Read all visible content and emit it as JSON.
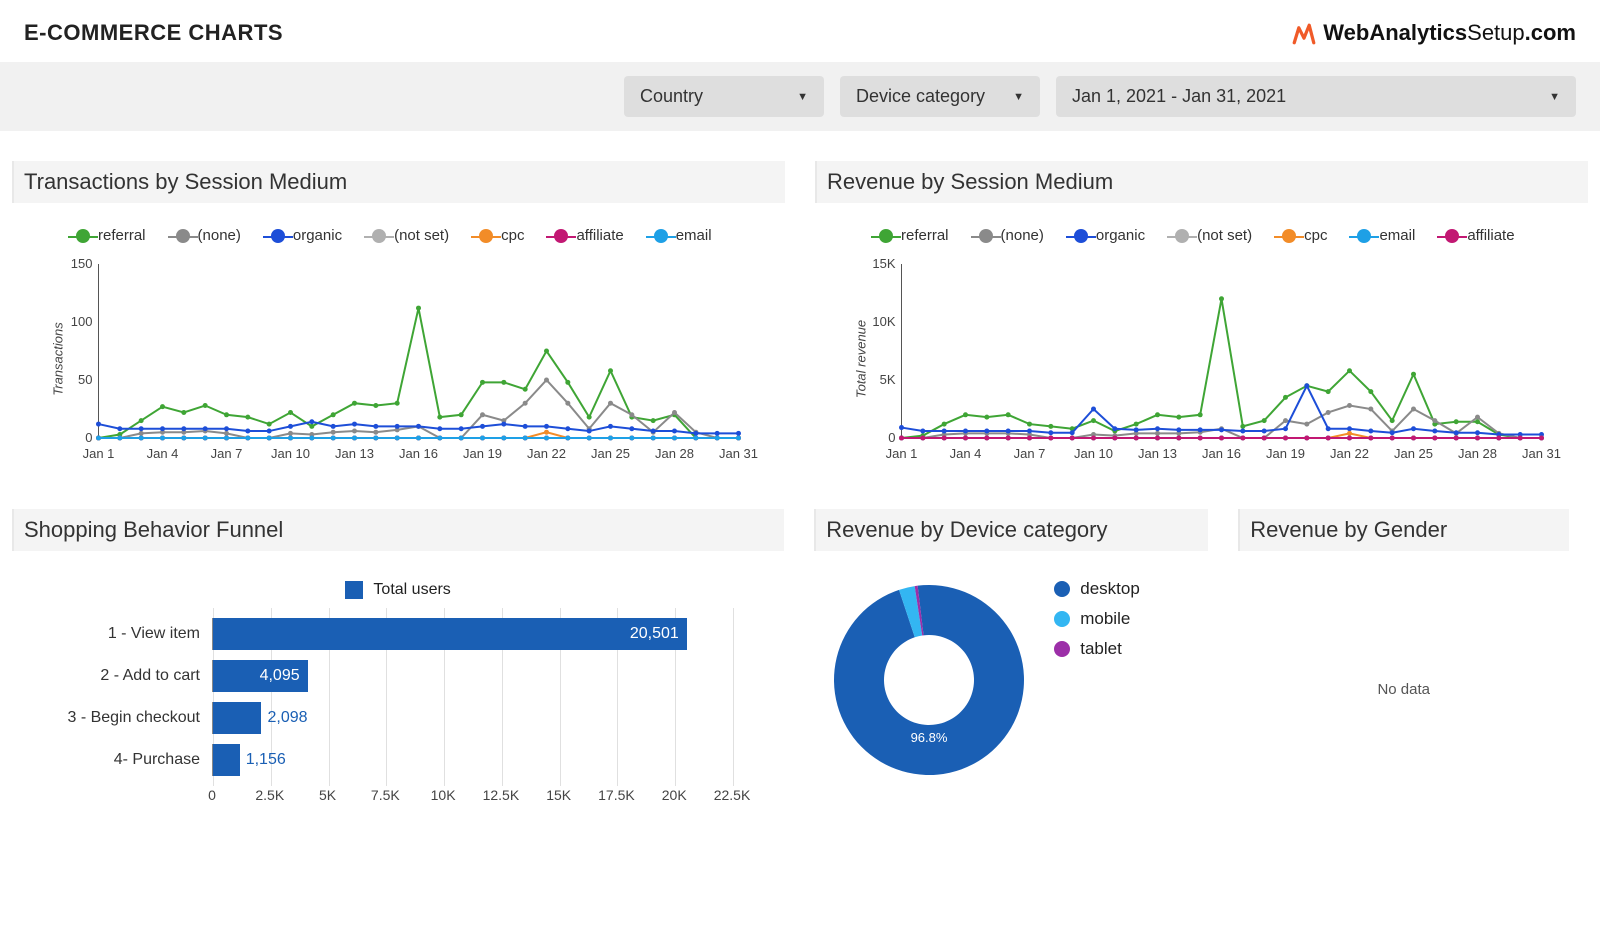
{
  "header": {
    "title": "E-COMMERCE CHARTS",
    "brand_prefix_bold": "WebAnalytics",
    "brand_prefix_light": "Setup",
    "brand_suffix": ".com"
  },
  "filters": {
    "country_label": "Country",
    "device_label": "Device category",
    "date_label": "Jan 1, 2021 - Jan 31, 2021"
  },
  "colors": {
    "referral": "#3fa535",
    "none": "#8a8a8a",
    "organic": "#1d4ed8",
    "notset": "#b0b0b0",
    "cpc": "#f28c28",
    "affiliate": "#c21873",
    "email": "#1ea0e6",
    "bar": "#1a5fb4",
    "desktop": "#1a5fb4",
    "mobile": "#33b6f2",
    "tablet": "#9c2fa8"
  },
  "chart_data": [
    {
      "id": "transactions_by_medium",
      "title": "Transactions by Session Medium",
      "type": "line",
      "ylabel": "Transactions",
      "x": [
        1,
        2,
        3,
        4,
        5,
        6,
        7,
        8,
        9,
        10,
        11,
        12,
        13,
        14,
        15,
        16,
        17,
        18,
        19,
        20,
        21,
        22,
        23,
        24,
        25,
        26,
        27,
        28,
        29,
        30,
        31
      ],
      "x_ticks": [
        "Jan 1",
        "Jan 4",
        "Jan 7",
        "Jan 10",
        "Jan 13",
        "Jan 16",
        "Jan 19",
        "Jan 22",
        "Jan 25",
        "Jan 28",
        "Jan 31"
      ],
      "ylim": [
        0,
        150
      ],
      "y_ticks": [
        0,
        50,
        100,
        150
      ],
      "series": [
        {
          "name": "referral",
          "legend": "referral",
          "values": [
            0,
            3,
            15,
            27,
            22,
            28,
            20,
            18,
            12,
            22,
            10,
            20,
            30,
            28,
            30,
            112,
            18,
            20,
            48,
            48,
            42,
            75,
            48,
            18,
            58,
            18,
            15,
            20,
            0,
            0,
            0
          ]
        },
        {
          "name": "none",
          "legend": "(none)",
          "values": [
            0,
            0,
            4,
            5,
            5,
            6,
            4,
            0,
            0,
            4,
            3,
            5,
            6,
            5,
            7,
            10,
            0,
            0,
            20,
            15,
            30,
            50,
            30,
            8,
            30,
            20,
            5,
            22,
            5,
            0,
            0
          ]
        },
        {
          "name": "organic",
          "legend": "organic",
          "values": [
            12,
            8,
            8,
            8,
            8,
            8,
            8,
            6,
            6,
            10,
            14,
            10,
            12,
            10,
            10,
            10,
            8,
            8,
            10,
            12,
            10,
            10,
            8,
            6,
            10,
            8,
            6,
            6,
            4,
            4,
            4
          ]
        },
        {
          "name": "notset",
          "legend": "(not set)",
          "values": [
            0,
            0,
            0,
            0,
            0,
            0,
            0,
            0,
            0,
            0,
            0,
            0,
            0,
            0,
            0,
            0,
            0,
            0,
            0,
            0,
            0,
            0,
            0,
            0,
            0,
            0,
            0,
            0,
            0,
            0,
            0
          ]
        },
        {
          "name": "cpc",
          "legend": "cpc",
          "values": [
            0,
            0,
            0,
            0,
            0,
            0,
            0,
            0,
            0,
            0,
            0,
            0,
            0,
            0,
            0,
            0,
            0,
            0,
            0,
            0,
            0,
            5,
            0,
            0,
            0,
            0,
            0,
            0,
            0,
            0,
            0
          ]
        },
        {
          "name": "affiliate",
          "legend": "affiliate",
          "values": [
            0,
            0,
            0,
            0,
            0,
            0,
            0,
            0,
            0,
            0,
            0,
            0,
            0,
            0,
            0,
            0,
            0,
            0,
            0,
            0,
            0,
            0,
            0,
            0,
            0,
            0,
            0,
            0,
            0,
            0,
            0
          ]
        },
        {
          "name": "email",
          "legend": "email",
          "values": [
            0,
            0,
            0,
            0,
            0,
            0,
            0,
            0,
            0,
            0,
            0,
            0,
            0,
            0,
            0,
            0,
            0,
            0,
            0,
            0,
            0,
            0,
            0,
            0,
            0,
            0,
            0,
            0,
            0,
            0,
            0
          ]
        }
      ]
    },
    {
      "id": "revenue_by_medium",
      "title": "Revenue by Session Medium",
      "type": "line",
      "ylabel": "Total revenue",
      "x": [
        1,
        2,
        3,
        4,
        5,
        6,
        7,
        8,
        9,
        10,
        11,
        12,
        13,
        14,
        15,
        16,
        17,
        18,
        19,
        20,
        21,
        22,
        23,
        24,
        25,
        26,
        27,
        28,
        29,
        30,
        31
      ],
      "x_ticks": [
        "Jan 1",
        "Jan 4",
        "Jan 7",
        "Jan 10",
        "Jan 13",
        "Jan 16",
        "Jan 19",
        "Jan 22",
        "Jan 25",
        "Jan 28",
        "Jan 31"
      ],
      "ylim": [
        0,
        15000
      ],
      "y_ticks": [
        0,
        5000,
        10000,
        15000
      ],
      "y_tick_labels": [
        "0",
        "5K",
        "10K",
        "15K"
      ],
      "series": [
        {
          "name": "referral",
          "legend": "referral",
          "values": [
            0,
            200,
            1200,
            2000,
            1800,
            2000,
            1200,
            1000,
            800,
            1500,
            600,
            1200,
            2000,
            1800,
            2000,
            12000,
            1000,
            1500,
            3500,
            4500,
            4000,
            5800,
            4000,
            1500,
            5500,
            1200,
            1400,
            1400,
            300,
            0,
            0
          ]
        },
        {
          "name": "none",
          "legend": "(none)",
          "values": [
            0,
            0,
            300,
            400,
            400,
            400,
            300,
            0,
            0,
            300,
            200,
            400,
            400,
            400,
            500,
            800,
            0,
            0,
            1500,
            1200,
            2200,
            2800,
            2500,
            600,
            2500,
            1500,
            400,
            1800,
            400,
            0,
            0
          ]
        },
        {
          "name": "organic",
          "legend": "organic",
          "values": [
            900,
            600,
            600,
            600,
            600,
            600,
            600,
            450,
            450,
            2500,
            800,
            700,
            800,
            700,
            700,
            700,
            600,
            600,
            800,
            4500,
            800,
            800,
            600,
            450,
            800,
            600,
            450,
            450,
            300,
            300,
            300
          ]
        },
        {
          "name": "notset",
          "legend": "(not set)",
          "values": [
            0,
            0,
            0,
            0,
            0,
            0,
            0,
            0,
            0,
            0,
            0,
            0,
            0,
            0,
            0,
            0,
            0,
            0,
            0,
            0,
            0,
            0,
            0,
            0,
            0,
            0,
            0,
            0,
            0,
            0,
            0
          ]
        },
        {
          "name": "cpc",
          "legend": "cpc",
          "values": [
            0,
            0,
            0,
            0,
            0,
            0,
            0,
            0,
            0,
            0,
            0,
            0,
            0,
            0,
            0,
            0,
            0,
            0,
            0,
            0,
            0,
            400,
            0,
            0,
            0,
            0,
            0,
            0,
            0,
            0,
            0
          ]
        },
        {
          "name": "email",
          "legend": "email",
          "values": [
            0,
            0,
            0,
            0,
            0,
            0,
            0,
            0,
            0,
            0,
            0,
            0,
            0,
            0,
            0,
            0,
            0,
            0,
            0,
            0,
            0,
            0,
            0,
            0,
            0,
            0,
            0,
            0,
            0,
            0,
            0
          ]
        },
        {
          "name": "affiliate",
          "legend": "affiliate",
          "values": [
            0,
            0,
            0,
            0,
            0,
            0,
            0,
            0,
            0,
            0,
            0,
            0,
            0,
            0,
            0,
            0,
            0,
            0,
            0,
            0,
            0,
            0,
            0,
            0,
            0,
            0,
            0,
            0,
            0,
            0,
            0
          ]
        }
      ]
    },
    {
      "id": "shopping_funnel",
      "title": "Shopping Behavior Funnel",
      "type": "bar",
      "legend": "Total users",
      "xlim": [
        0,
        22500
      ],
      "x_ticks": [
        0,
        2500,
        5000,
        7500,
        10000,
        12500,
        15000,
        17500,
        20000,
        22500
      ],
      "x_tick_labels": [
        "0",
        "2.5K",
        "5K",
        "7.5K",
        "10K",
        "12.5K",
        "15K",
        "17.5K",
        "20K",
        "22.5K"
      ],
      "categories": [
        "1 - View item",
        "2 - Add to cart",
        "3 - Begin checkout",
        "4- Purchase"
      ],
      "values": [
        20501,
        4095,
        2098,
        1156
      ],
      "value_labels": [
        "20,501",
        "4,095",
        "2,098",
        "1,156"
      ]
    },
    {
      "id": "revenue_by_device",
      "title": "Revenue by Device category",
      "type": "pie",
      "series": [
        {
          "name": "desktop",
          "value": 96.8,
          "label": "96.8%"
        },
        {
          "name": "mobile",
          "value": 2.7
        },
        {
          "name": "tablet",
          "value": 0.5
        }
      ]
    },
    {
      "id": "revenue_by_gender",
      "title": "Revenue by Gender",
      "type": "table",
      "empty_text": "No data"
    }
  ]
}
